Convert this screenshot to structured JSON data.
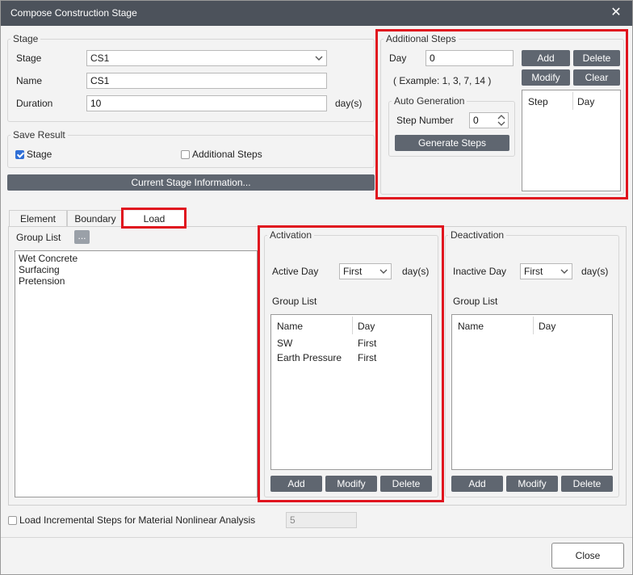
{
  "window": {
    "title": "Compose Construction Stage",
    "close_glyph": "✕"
  },
  "stage": {
    "legend": "Stage",
    "stage_label": "Stage",
    "stage_value": "CS1",
    "name_label": "Name",
    "name_value": "CS1",
    "duration_label": "Duration",
    "duration_value": "10",
    "duration_unit": "day(s)"
  },
  "save_result": {
    "legend": "Save Result",
    "stage_label": "Stage",
    "stage_checked": true,
    "additional_label": "Additional Steps",
    "additional_checked": false
  },
  "current_stage_button": "Current Stage Information...",
  "additional_steps": {
    "legend": "Additional Steps",
    "day_label": "Day",
    "day_value": "0",
    "example": "( Example: 1, 3, 7, 14 )",
    "add": "Add",
    "delete": "Delete",
    "modify": "Modify",
    "clear": "Clear",
    "auto_legend": "Auto Generation",
    "step_number_label": "Step Number",
    "step_number_value": "0",
    "generate": "Generate Steps",
    "list_headers": [
      "Step",
      "Day"
    ]
  },
  "tabs": [
    "Element",
    "Boundary",
    "Load"
  ],
  "active_tab": "Load",
  "group_list": {
    "label": "Group List",
    "browse": "...",
    "items": [
      "Wet Concrete",
      "Surfacing",
      "Pretension"
    ]
  },
  "activation": {
    "legend": "Activation",
    "day_label": "Active Day",
    "day_value": "First",
    "unit": "day(s)",
    "group_label": "Group List",
    "headers": [
      "Name",
      "Day"
    ],
    "rows": [
      {
        "name": "SW",
        "day": "First"
      },
      {
        "name": "Earth Pressure",
        "day": "First"
      }
    ],
    "add": "Add",
    "modify": "Modify",
    "delete": "Delete"
  },
  "deactivation": {
    "legend": "Deactivation",
    "day_label": "Inactive Day",
    "day_value": "First",
    "unit": "day(s)",
    "group_label": "Group List",
    "headers": [
      "Name",
      "Day"
    ],
    "add": "Add",
    "modify": "Modify",
    "delete": "Delete"
  },
  "incremental": {
    "label": "Load Incremental Steps for Material Nonlinear Analysis",
    "checked": false,
    "value": "5"
  },
  "close_button": "Close",
  "colors": {
    "highlight": "#e0141e",
    "button": "#5f6670",
    "titlebar": "#4c525b",
    "check": "#2f6fd6"
  }
}
